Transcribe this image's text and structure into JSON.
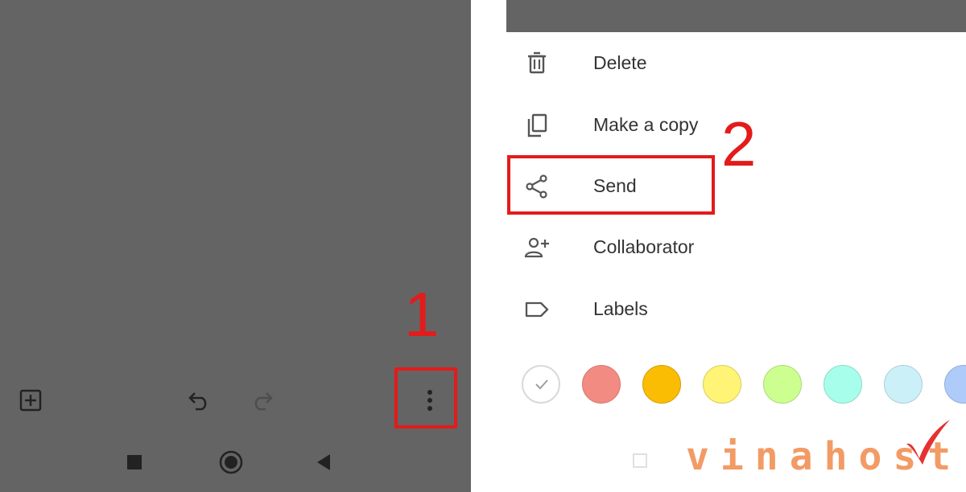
{
  "menu": {
    "items": [
      {
        "label": "Delete",
        "icon": "trash-icon"
      },
      {
        "label": "Make a copy",
        "icon": "copy-icon"
      },
      {
        "label": "Send",
        "icon": "share-icon"
      },
      {
        "label": "Collaborator",
        "icon": "add-person-icon"
      },
      {
        "label": "Labels",
        "icon": "label-icon"
      }
    ]
  },
  "annotations": {
    "step1": "1",
    "step2": "2"
  },
  "colors": {
    "accent_red": "#e31b1b",
    "dim_background": "#646464",
    "swatches": [
      "#ffffff",
      "#f28b82",
      "#fbbc04",
      "#fff475",
      "#ccff90",
      "#a7ffeb",
      "#cbf0f8",
      "#aecbfa"
    ]
  },
  "watermark": {
    "text": "vinahost."
  }
}
